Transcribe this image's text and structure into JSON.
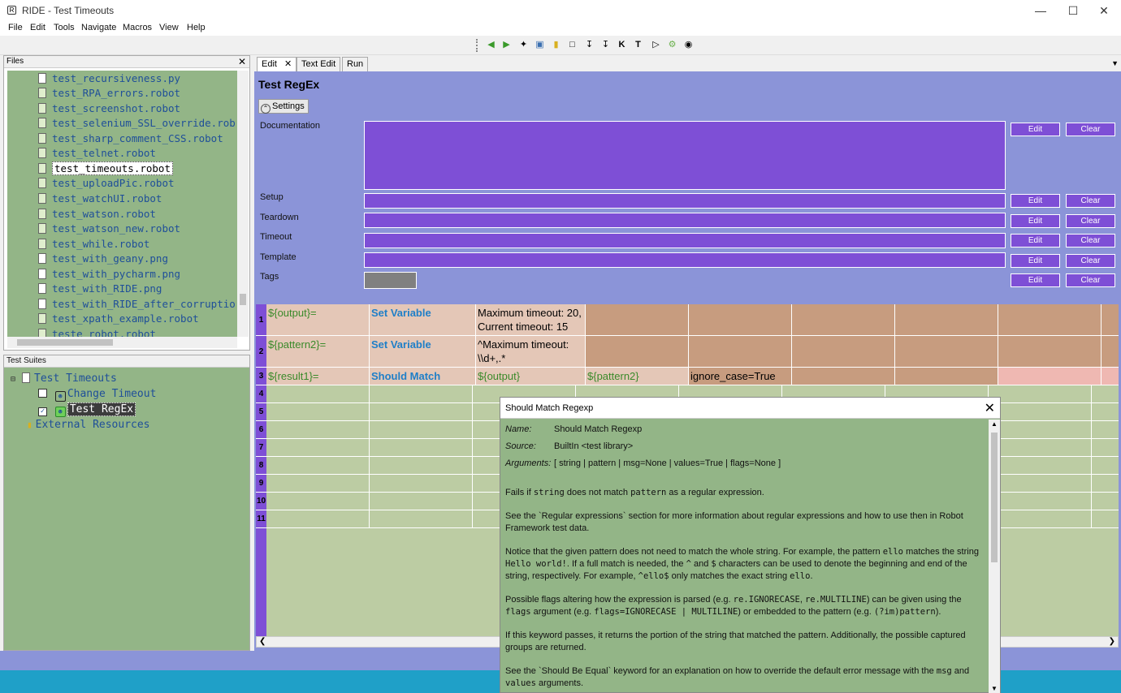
{
  "window": {
    "title": "RIDE - Test Timeouts"
  },
  "menu": [
    "File",
    "Edit",
    "Tools",
    "Navigate",
    "Macros",
    "View",
    "Help"
  ],
  "files_panel": {
    "title": "Files",
    "items": [
      "test_recursiveness.py",
      "test_RPA_errors.robot",
      "test_screenshot.robot",
      "test_selenium_SSL_override.rob",
      "test_sharp_comment_CSS.robot",
      "test_telnet.robot",
      "test_timeouts.robot",
      "test_uploadPic.robot",
      "test_watchUI.robot",
      "test_watson.robot",
      "test_watson_new.robot",
      "test_while.robot",
      "test_with_geany.png",
      "test_with_pycharm.png",
      "test_with_RIDE.png",
      "test_with_RIDE_after_corruptio",
      "test_xpath_example.robot",
      "teste_robot.robot"
    ]
  },
  "suites_panel": {
    "title": "Test Suites",
    "root": "Test Timeouts",
    "children": [
      "Change Timeout",
      "Test RegEx"
    ],
    "external": "External Resources"
  },
  "editor": {
    "tabs": [
      "Edit",
      "Text Edit",
      "Run"
    ],
    "test_name": "Test RegEx",
    "settings_label": "Settings",
    "fields": [
      "Documentation",
      "Setup",
      "Teardown",
      "Timeout",
      "Template",
      "Tags"
    ],
    "edit_label": "Edit",
    "clear_label": "Clear",
    "rows": [
      [
        "1",
        "${output}=",
        "Set Variable",
        "Maximum timeout: 20, Current timeout: 15",
        ""
      ],
      [
        "2",
        "${pattern2}=",
        "Set Variable",
        "^Maximum timeout: \\\\d+,.*",
        ""
      ],
      [
        "3",
        "${result1}=",
        "Should Match",
        "${output}",
        "${pattern2}",
        "ignore_case=True"
      ],
      [
        "4"
      ],
      [
        "5"
      ],
      [
        "6"
      ],
      [
        "7"
      ],
      [
        "8"
      ],
      [
        "9"
      ],
      [
        "10"
      ],
      [
        "11"
      ]
    ]
  },
  "popup": {
    "title": "Should Match Regexp",
    "name_key": "Name:",
    "name_val": "Should Match Regexp",
    "source_key": "Source:",
    "source_val": "BuiltIn <test library>",
    "args_key": "Arguments:",
    "args_val": "[ string | pattern | msg=None | values=True | flags=None ]",
    "p1_a": "Fails if ",
    "p1_code1": "string",
    "p1_b": " does not match ",
    "p1_code2": "pattern",
    "p1_c": " as a regular expression.",
    "p2": "See the `Regular expressions` section for more information about regular expressions and how to use then in Robot Framework test data.",
    "p3_a": "Notice that the given pattern does not need to match the whole string. For example, the pattern ",
    "p3_code1": "ello",
    "p3_b": " matches the string ",
    "p3_code2": "Hello world!",
    "p3_c": ". If a full match is needed, the ",
    "p3_code3": "^",
    "p3_d": " and ",
    "p3_code4": "$",
    "p3_e": " characters can be used to denote the beginning and end of the string, respectively. For example, ",
    "p3_code5": "^ello$",
    "p3_f": " only matches the exact string ",
    "p3_code6": "ello",
    "p3_g": ".",
    "p4_a": "Possible flags altering how the expression is parsed (e.g. ",
    "p4_code1": "re.IGNORECASE",
    "p4_b": ", ",
    "p4_code2": "re.MULTILINE",
    "p4_c": ") can be given using the ",
    "p4_code3": "flags",
    "p4_d": " argument (e.g. ",
    "p4_code4": "flags=IGNORECASE | MULTILINE",
    "p4_e": ") or embedded to the pattern (e.g. ",
    "p4_code5": "(?im)pattern",
    "p4_f": ").",
    "p5": "If this keyword passes, it returns the portion of the string that matched the pattern. Additionally, the possible captured groups are returned.",
    "p6_a": "See the `Should Be Equal` keyword for an explanation on how to override the default error message with the ",
    "p6_code1": "msg",
    "p6_b": " and ",
    "p6_code2": "values",
    "p6_c": " arguments."
  }
}
